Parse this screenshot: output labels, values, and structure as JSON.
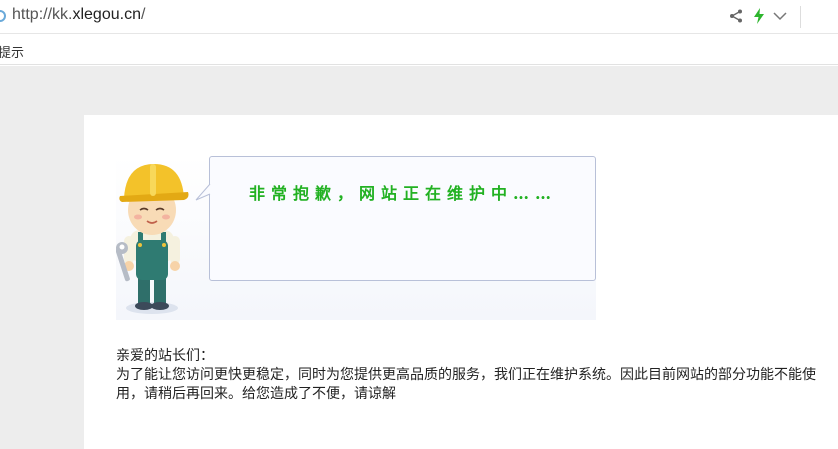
{
  "addressbar": {
    "url_scheme": "http://kk.",
    "url_host": "xlegou.cn",
    "url_tail": "/"
  },
  "bookmarks": {
    "partial_label": "提示"
  },
  "notice": {
    "headline": "非常抱歉，网站正在维护中……",
    "greeting": "亲爱的站长们：",
    "paragraph": "为了能让您访问更快更稳定，同时为您提供更高品质的服务，我们正在维护系统。因此目前网站的部分功能不能使用，请稍后再回来。给您造成了不便，请谅解"
  },
  "colors": {
    "accent_green": "#22b122",
    "bolt_green": "#2db52d"
  },
  "icons": [
    "site-icon",
    "share-icon",
    "lightning-icon",
    "chevron-down-icon",
    "worker-illustration"
  ]
}
